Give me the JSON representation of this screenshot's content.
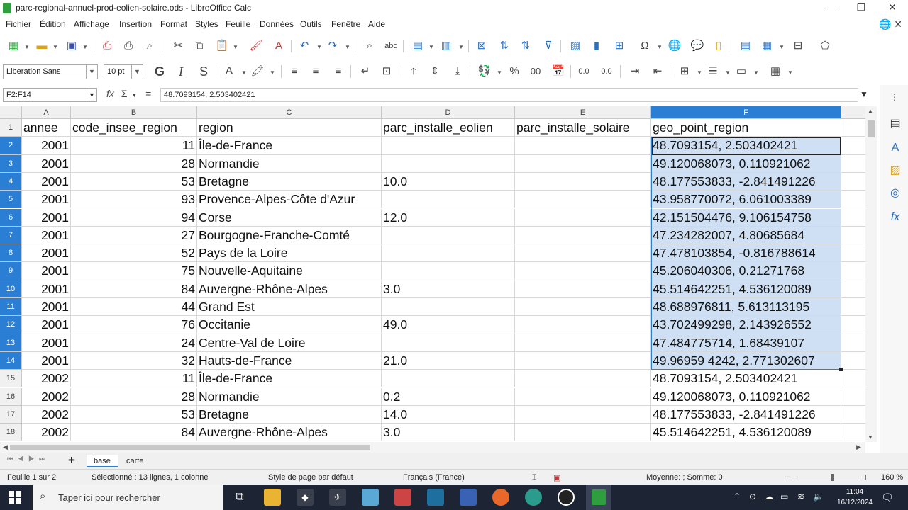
{
  "window": {
    "title": "parc-regional-annuel-prod-eolien-solaire.ods - LibreOffice Calc",
    "minimize": "—",
    "restore": "❐",
    "close": "✕"
  },
  "menu": [
    "Fichier",
    "Édition",
    "Affichage",
    "Insertion",
    "Format",
    "Styles",
    "Feuille",
    "Données",
    "Outils",
    "Fenêtre",
    "Aide"
  ],
  "formatting": {
    "font_name": "Liberation Sans",
    "font_size": "10 pt",
    "bold": "G",
    "italic": "I",
    "underline": "S",
    "percent": "%",
    "decimal_a": "0.0",
    "decimal_b": "0.0",
    "number": "00"
  },
  "formula_bar": {
    "name_box": "F2:F14",
    "function_icon": "fx",
    "sum_icon": "Σ",
    "equals": "=",
    "content": "48.7093154, 2.503402421"
  },
  "columns": [
    "A",
    "B",
    "C",
    "D",
    "E",
    "F"
  ],
  "rows": [
    {
      "n": "1",
      "a": "annee",
      "b": "code_insee_region",
      "c": "region",
      "d": "parc_installe_eolien",
      "e": "parc_installe_solaire",
      "f": "geo_point_region"
    },
    {
      "n": "2",
      "a": "2001",
      "b": "11",
      "c": "Île-de-France",
      "d": "",
      "e": "",
      "f": "48.7093154, 2.503402421"
    },
    {
      "n": "3",
      "a": "2001",
      "b": "28",
      "c": "Normandie",
      "d": "",
      "e": "",
      "f": "49.120068073, 0.110921062"
    },
    {
      "n": "4",
      "a": "2001",
      "b": "53",
      "c": "Bretagne",
      "d": "10.0",
      "e": "",
      "f": "48.177553833, -2.841491226"
    },
    {
      "n": "5",
      "a": "2001",
      "b": "93",
      "c": "Provence-Alpes-Côte d'Azur",
      "d": "",
      "e": "",
      "f": "43.958770072, 6.061003389"
    },
    {
      "n": "6",
      "a": "2001",
      "b": "94",
      "c": "Corse",
      "d": "12.0",
      "e": "",
      "f": "42.151504476, 9.106154758"
    },
    {
      "n": "7",
      "a": "2001",
      "b": "27",
      "c": "Bourgogne-Franche-Comté",
      "d": "",
      "e": "",
      "f": "47.234282007, 4.80685684"
    },
    {
      "n": "8",
      "a": "2001",
      "b": "52",
      "c": "Pays de la Loire",
      "d": "",
      "e": "",
      "f": "47.478103854, -0.816788614"
    },
    {
      "n": "9",
      "a": "2001",
      "b": "75",
      "c": "Nouvelle-Aquitaine",
      "d": "",
      "e": "",
      "f": "45.206040306, 0.21271768"
    },
    {
      "n": "10",
      "a": "2001",
      "b": "84",
      "c": "Auvergne-Rhône-Alpes",
      "d": "3.0",
      "e": "",
      "f": "45.514642251, 4.536120089"
    },
    {
      "n": "11",
      "a": "2001",
      "b": "44",
      "c": "Grand Est",
      "d": "",
      "e": "",
      "f": "48.688976811, 5.613113195"
    },
    {
      "n": "12",
      "a": "2001",
      "b": "76",
      "c": "Occitanie",
      "d": "49.0",
      "e": "",
      "f": "43.702499298, 2.143926552"
    },
    {
      "n": "13",
      "a": "2001",
      "b": "24",
      "c": "Centre-Val de Loire",
      "d": "",
      "e": "",
      "f": "47.484775714, 1.68439107"
    },
    {
      "n": "14",
      "a": "2001",
      "b": "32",
      "c": "Hauts-de-France",
      "d": "21.0",
      "e": "",
      "f": "49.96959 4242, 2.771302607"
    },
    {
      "n": "15",
      "a": "2002",
      "b": "11",
      "c": "Île-de-France",
      "d": "",
      "e": "",
      "f": "48.7093154, 2.503402421"
    },
    {
      "n": "16",
      "a": "2002",
      "b": "28",
      "c": "Normandie",
      "d": "0.2",
      "e": "",
      "f": "49.120068073, 0.110921062"
    },
    {
      "n": "17",
      "a": "2002",
      "b": "53",
      "c": "Bretagne",
      "d": "14.0",
      "e": "",
      "f": "48.177553833, -2.841491226"
    },
    {
      "n": "18",
      "a": "2002",
      "b": "84",
      "c": "Auvergne-Rhône-Alpes",
      "d": "3.0",
      "e": "",
      "f": "45.514642251, 4.536120089"
    }
  ],
  "sheet_tabs": {
    "add": "+",
    "tabs": [
      "base",
      "carte"
    ]
  },
  "status": {
    "sheet": "Feuille 1 sur 2",
    "selection": "Sélectionné : 13 lignes, 1 colonne",
    "page_style": "Style de page par défaut",
    "language": "Français (France)",
    "aggregate": "Moyenne: ; Somme: 0",
    "zoom_minus": "−",
    "zoom_plus": "+",
    "zoom": "160 %"
  },
  "taskbar": {
    "search_placeholder": "Taper ici pour rechercher",
    "time": "11:04",
    "date": "16/12/2024"
  },
  "colors": {
    "selection_header": "#2a7fd4",
    "selection_fill": "#cfe0f4",
    "calc_green": "#2e9e3e",
    "taskbar": "#1d2433"
  }
}
